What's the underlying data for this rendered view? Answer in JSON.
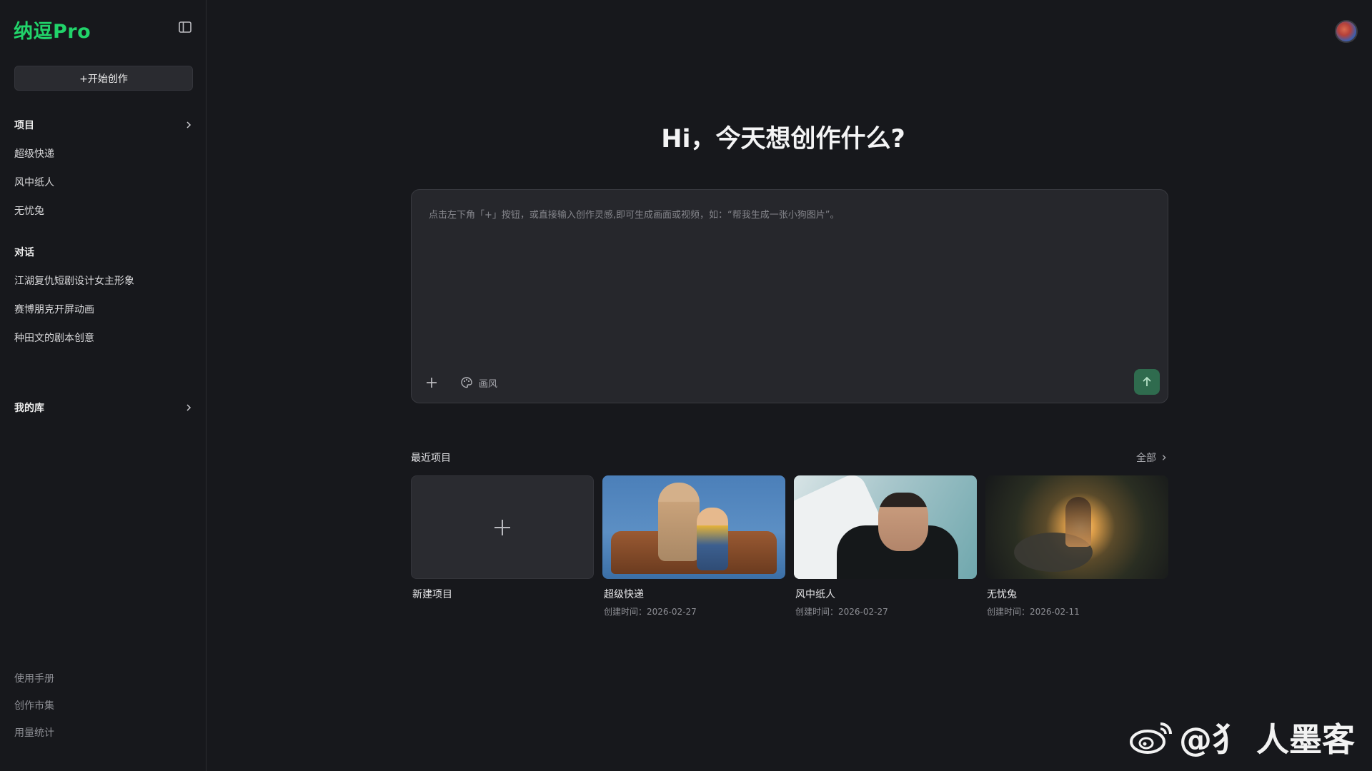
{
  "sidebar": {
    "brand": "纳逗Pro",
    "new_button": "+开始创作",
    "projects_header": "项目",
    "projects": [
      "超级快递",
      "风中纸人",
      "无忧兔"
    ],
    "dialogs_header": "对话",
    "dialogs": [
      "江湖复仇短剧设计女主形象",
      "赛博朋克开屏动画",
      "种田文的剧本创意"
    ],
    "library_header": "我的库",
    "footer": [
      "使用手册",
      "创作市集",
      "用量统计"
    ]
  },
  "hero": {
    "title": "Hi，今天想创作什么?"
  },
  "prompt": {
    "placeholder": "点击左下角「+」按钮，或直接输入创作灵感,即可生成画面或视频，如：“帮我生成一张小狗图片”。",
    "style_label": "画风"
  },
  "recent": {
    "title": "最近项目",
    "view_all": "全部",
    "new_label": "新建项目",
    "items": [
      {
        "title": "超级快递",
        "date": "创建时间：2026-02-27"
      },
      {
        "title": "风中纸人",
        "date": "创建时间：2026-02-27"
      },
      {
        "title": "无忧兔",
        "date": "创建时间：2026-02-11"
      }
    ]
  },
  "watermark": {
    "text": "@犭 人墨客"
  },
  "colors": {
    "brand": "#21d36a",
    "send": "#2f6b4e",
    "background": "#17181c"
  },
  "icons": [
    "sidebar-toggle-icon",
    "chevron-right-icon",
    "plus-icon",
    "palette-icon",
    "arrow-up-icon",
    "weibo-icon"
  ]
}
